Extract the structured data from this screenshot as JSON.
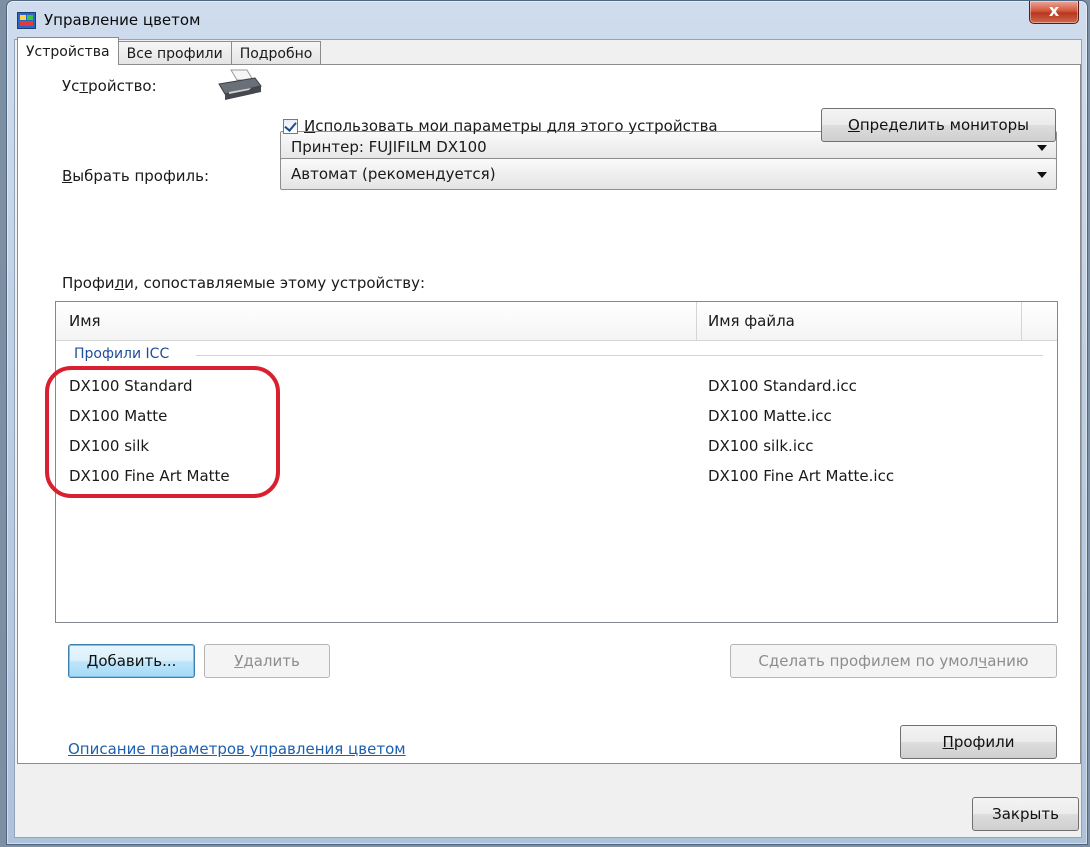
{
  "window": {
    "title": "Управление цветом",
    "close_glyph": "x"
  },
  "tabs": [
    {
      "label": "Устройства",
      "active": true
    },
    {
      "label": "Все профили",
      "active": false
    },
    {
      "label": "Подробно",
      "active": false
    }
  ],
  "device": {
    "label_prefix": "Ус",
    "label_underlined": "т",
    "label_suffix": "ройство:",
    "icon": "printer-icon",
    "selected": "Принтер: FUJIFILM DX100"
  },
  "use_settings": {
    "checked": true,
    "label_underlined": "И",
    "label_rest": "спользовать мои параметры для этого устройства"
  },
  "identify_monitors_button": {
    "label_underlined": "О",
    "label_rest": "пределить мониторы"
  },
  "profile_select": {
    "label_underlined": "В",
    "label_rest": "ыбрать профиль:",
    "selected": "Автомат (рекомендуется)"
  },
  "associated": {
    "label_prefix": "Профи",
    "label_underlined": "л",
    "label_suffix": "и, сопоставляемые этому устройству:"
  },
  "list": {
    "columns": [
      "Имя",
      "Имя файла"
    ],
    "group": "Профили ICC",
    "rows": [
      {
        "name": "DX100 Standard",
        "file": "DX100 Standard.icc"
      },
      {
        "name": "DX100 Matte",
        "file": "DX100 Matte.icc"
      },
      {
        "name": "DX100 silk",
        "file": "DX100 silk.icc"
      },
      {
        "name": "DX100 Fine Art Matte",
        "file": "DX100 Fine Art Matte.icc"
      }
    ]
  },
  "buttons": {
    "add": {
      "label_underlined": "Д",
      "label_rest": "обавить..."
    },
    "remove": {
      "label_underlined": "У",
      "label_rest": "далить"
    },
    "set_default": {
      "label_prefix": "Сделать профилем по умол",
      "label_underlined": "ч",
      "label_suffix": "анию"
    },
    "profiles": {
      "label_underlined": "П",
      "label_rest": "рофили"
    },
    "close": "Закрыть"
  },
  "link": "Описание параметров управления цветом",
  "colors": {
    "annotation": "#d9202e",
    "link": "#1b5fb0",
    "group_header": "#1e4e9c"
  }
}
